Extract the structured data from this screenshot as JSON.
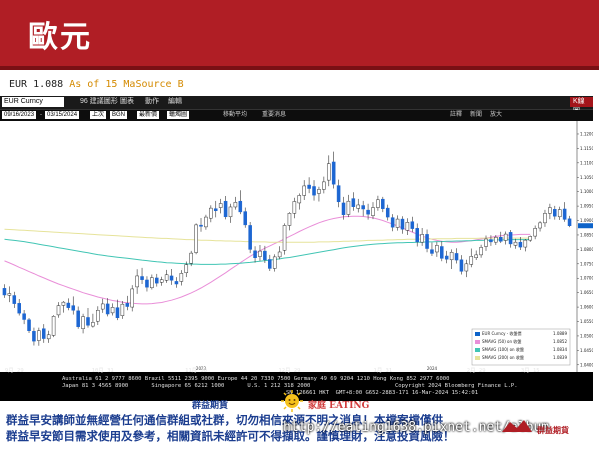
{
  "banner": {
    "title": "歐元"
  },
  "source": {
    "ticker": "EUR 1.088",
    "label": "As of 15 Ma",
    "source": "Source B"
  },
  "toolbar": {
    "ticker": "EUR Curncy",
    "items": [
      "96 建議圖形",
      "圖表",
      "動作",
      "編輯"
    ],
    "right_label": "K線圖"
  },
  "toolbar2": {
    "start_date": "09/16/2023",
    "end_date": "03/15/2024",
    "period_button": "上次",
    "currency": "BGN",
    "frequency": "最新價",
    "chart_type": "蠟燭圖",
    "checkbox_1": "移動平均",
    "checkbox_2": "重要消息",
    "right_items": [
      "註釋",
      "新聞",
      "放大"
    ]
  },
  "footer": {
    "line1": "Australia 61 2 9777 8600 Brazil 5511 2395 9000 Europe 44 20 7330 7500 Germany 49 69 9204 1210 Hong Kong 852 2977 6000",
    "line2": "Japan 81 3 4565 8900       Singapore 65 6212 1000       U.S. 1 212 318 2000",
    "line3": "SN 126661 HKT  GMT+8:00 G652-2883-171 16-Mar-2024 15:42:01",
    "copyright": "Copyright 2024 Bloomberg Finance L.P."
  },
  "chart_data": {
    "type": "candlestick",
    "ylim": [
      1.0375,
      1.1245
    ],
    "y_ticks": [
      1.04,
      1.045,
      1.05,
      1.055,
      1.06,
      1.065,
      1.07,
      1.075,
      1.08,
      1.085,
      1.09,
      1.095,
      1.1,
      1.105,
      1.11,
      1.115,
      1.12
    ],
    "y_tick_labels": [
      "1.0400",
      "1.0450",
      "1.0500",
      "1.0550",
      "1.0600",
      "1.0650",
      "1.0700",
      "1.0750",
      "1.0800",
      "1.0850",
      "1.0900",
      "1.0950",
      "1.1000",
      "1.1050",
      "1.1100",
      "1.1150",
      "1.1200"
    ],
    "x_ticks": [
      {
        "index": 2,
        "label": "9月 29"
      },
      {
        "index": 20,
        "label": "10月 31"
      },
      {
        "index": 39,
        "label": "11月 30"
      },
      {
        "index": 58,
        "label": "12月 29"
      },
      {
        "index": 77,
        "label": "1月 31"
      },
      {
        "index": 96,
        "label": "2月 29"
      },
      {
        "index": 107,
        "label": "3月 15"
      }
    ],
    "x_year_labels": [
      {
        "index": 40,
        "label": "2023"
      },
      {
        "index": 87,
        "label": "2024"
      }
    ],
    "candles": [
      [
        1.0665,
        1.0679,
        1.0632,
        1.0642
      ],
      [
        1.0641,
        1.0672,
        1.0617,
        1.0647
      ],
      [
        1.064,
        1.0653,
        1.0597,
        1.0612
      ],
      [
        1.0613,
        1.0628,
        1.0571,
        1.0579
      ],
      [
        1.0577,
        1.059,
        1.0541,
        1.0557
      ],
      [
        1.0556,
        1.0562,
        1.051,
        1.0518
      ],
      [
        1.0516,
        1.0529,
        1.0467,
        1.0482
      ],
      [
        1.0484,
        1.0529,
        1.0466,
        1.0518
      ],
      [
        1.0525,
        1.0541,
        1.0476,
        1.0491
      ],
      [
        1.049,
        1.0518,
        1.0476,
        1.0504
      ],
      [
        1.0502,
        1.0572,
        1.0496,
        1.0568
      ],
      [
        1.0573,
        1.0617,
        1.0563,
        1.0605
      ],
      [
        1.0606,
        1.0621,
        1.0581,
        1.0617
      ],
      [
        1.0614,
        1.063,
        1.0589,
        1.0598
      ],
      [
        1.0605,
        1.0637,
        1.0574,
        1.0589
      ],
      [
        1.0587,
        1.0602,
        1.0525,
        1.0532
      ],
      [
        1.0525,
        1.0577,
        1.0509,
        1.0567
      ],
      [
        1.0564,
        1.0597,
        1.0529,
        1.0537
      ],
      [
        1.0534,
        1.0577,
        1.0529,
        1.0547
      ],
      [
        1.0551,
        1.0603,
        1.0538,
        1.0589
      ],
      [
        1.0593,
        1.0629,
        1.058,
        1.0611
      ],
      [
        1.0611,
        1.0631,
        1.0568,
        1.0576
      ],
      [
        1.058,
        1.0613,
        1.0571,
        1.0599
      ],
      [
        1.0598,
        1.0626,
        1.0555,
        1.0563
      ],
      [
        1.057,
        1.0621,
        1.0559,
        1.061
      ],
      [
        1.0613,
        1.0639,
        1.0589,
        1.0602
      ],
      [
        1.06,
        1.0676,
        1.0585,
        1.0663
      ],
      [
        1.067,
        1.0731,
        1.0646,
        1.0708
      ],
      [
        1.0706,
        1.0736,
        1.068,
        1.0695
      ],
      [
        1.0694,
        1.0707,
        1.0654,
        1.0669
      ],
      [
        1.0667,
        1.0713,
        1.0661,
        1.0702
      ],
      [
        1.0701,
        1.0715,
        1.0671,
        1.0683
      ],
      [
        1.0686,
        1.0705,
        1.0674,
        1.0695
      ],
      [
        1.0693,
        1.0729,
        1.0684,
        1.0712
      ],
      [
        1.0708,
        1.0732,
        1.0677,
        1.0693
      ],
      [
        1.0689,
        1.0704,
        1.0667,
        1.068
      ],
      [
        1.0689,
        1.0728,
        1.0675,
        1.0717
      ],
      [
        1.0719,
        1.0758,
        1.0704,
        1.0747
      ],
      [
        1.0752,
        1.0795,
        1.0742,
        1.0787
      ],
      [
        1.0789,
        1.089,
        1.0783,
        1.0885
      ],
      [
        1.0884,
        1.0909,
        1.0861,
        1.088
      ],
      [
        1.0878,
        1.092,
        1.0868,
        1.0912
      ],
      [
        1.0908,
        1.0953,
        1.0894,
        1.0943
      ],
      [
        1.0941,
        1.0968,
        1.0911,
        1.0934
      ],
      [
        1.0945,
        1.0975,
        1.0925,
        1.0959
      ],
      [
        1.0967,
        1.0985,
        1.0904,
        1.0913
      ],
      [
        1.0913,
        1.0958,
        1.0892,
        1.0947
      ],
      [
        1.0947,
        1.0982,
        1.0938,
        1.0963
      ],
      [
        1.0967,
        1.1005,
        1.0922,
        1.093
      ],
      [
        1.0931,
        1.0945,
        1.0875,
        1.0885
      ],
      [
        1.0883,
        1.0895,
        1.0787,
        1.08
      ],
      [
        1.0795,
        1.0811,
        1.0754,
        1.0771
      ],
      [
        1.0775,
        1.0815,
        1.076,
        1.0794
      ],
      [
        1.0794,
        1.0812,
        1.0753,
        1.0764
      ],
      [
        1.0765,
        1.0781,
        1.0725,
        1.0734
      ],
      [
        1.0734,
        1.0783,
        1.0723,
        1.0774
      ],
      [
        1.0774,
        1.0811,
        1.0766,
        1.0791
      ],
      [
        1.0797,
        1.089,
        1.0782,
        1.0883
      ],
      [
        1.0883,
        1.0929,
        1.0866,
        1.0925
      ],
      [
        1.0925,
        1.0979,
        1.0908,
        1.0966
      ],
      [
        1.0961,
        1.0994,
        1.0938,
        1.0987
      ],
      [
        1.0987,
        1.104,
        1.0971,
        1.102
      ],
      [
        1.1023,
        1.105,
        1.0995,
        1.1011
      ],
      [
        1.1018,
        1.104,
        1.0969,
        1.0988
      ],
      [
        1.0994,
        1.1017,
        1.0966,
        1.1008
      ],
      [
        1.1008,
        1.1052,
        1.0994,
        1.1034
      ],
      [
        1.104,
        1.1126,
        1.1019,
        1.1097
      ],
      [
        1.1103,
        1.1139,
        1.1011,
        1.1026
      ],
      [
        1.1021,
        1.1042,
        1.0946,
        1.0965
      ],
      [
        1.0961,
        1.0982,
        1.0903,
        1.092
      ],
      [
        1.0921,
        1.0989,
        1.0912,
        1.0967
      ],
      [
        1.0976,
        1.0998,
        1.0934,
        1.0948
      ],
      [
        1.0942,
        1.0975,
        1.0928,
        1.0954
      ],
      [
        1.0952,
        1.0968,
        1.0915,
        1.094
      ],
      [
        1.0936,
        1.0958,
        1.0903,
        1.0922
      ],
      [
        1.0917,
        1.0964,
        1.0905,
        1.0945
      ],
      [
        1.0945,
        1.0986,
        1.0934,
        1.0972
      ],
      [
        1.0974,
        1.0982,
        1.0929,
        1.0941
      ],
      [
        1.0943,
        1.0955,
        1.09,
        1.0912
      ],
      [
        1.091,
        1.0922,
        1.0863,
        1.0877
      ],
      [
        1.0876,
        1.0918,
        1.0865,
        1.0905
      ],
      [
        1.0905,
        1.0915,
        1.0854,
        1.087
      ],
      [
        1.0866,
        1.0908,
        1.085,
        1.0894
      ],
      [
        1.0896,
        1.0913,
        1.086,
        1.0872
      ],
      [
        1.0873,
        1.089,
        1.081,
        1.0826
      ],
      [
        1.0825,
        1.0874,
        1.0812,
        1.0852
      ],
      [
        1.0852,
        1.0869,
        1.079,
        1.0803
      ],
      [
        1.0799,
        1.0824,
        1.0777,
        1.0786
      ],
      [
        1.0791,
        1.0826,
        1.0774,
        1.0814
      ],
      [
        1.081,
        1.0828,
        1.0759,
        1.0769
      ],
      [
        1.0777,
        1.0795,
        1.0752,
        1.0766
      ],
      [
        1.0764,
        1.08,
        1.0732,
        1.079
      ],
      [
        1.0786,
        1.0804,
        1.0751,
        1.0763
      ],
      [
        1.0764,
        1.078,
        1.0713,
        1.0724
      ],
      [
        1.0725,
        1.0764,
        1.0704,
        1.075
      ],
      [
        1.0748,
        1.0803,
        1.0738,
        1.0776
      ],
      [
        1.0771,
        1.0796,
        1.0763,
        1.0781
      ],
      [
        1.0781,
        1.0816,
        1.0771,
        1.0807
      ],
      [
        1.081,
        1.0848,
        1.0795,
        1.0836
      ],
      [
        1.0834,
        1.0849,
        1.0812,
        1.0826
      ],
      [
        1.0825,
        1.085,
        1.0815,
        1.0842
      ],
      [
        1.0842,
        1.0861,
        1.0822,
        1.0828
      ],
      [
        1.0831,
        1.0862,
        1.0817,
        1.0853
      ],
      [
        1.0859,
        1.0867,
        1.0806,
        1.0819
      ],
      [
        1.0814,
        1.0837,
        1.0802,
        1.0825
      ],
      [
        1.0825,
        1.0843,
        1.0798,
        1.0808
      ],
      [
        1.0808,
        1.0836,
        1.0793,
        1.0832
      ],
      [
        1.0832,
        1.0848,
        1.0826,
        1.0845
      ],
      [
        1.0846,
        1.0883,
        1.0835,
        1.0873
      ],
      [
        1.0874,
        1.0898,
        1.0862,
        1.0892
      ],
      [
        1.0892,
        1.0937,
        1.0878,
        1.0925
      ],
      [
        1.0925,
        1.0958,
        1.0905,
        1.0945
      ],
      [
        1.0939,
        1.0951,
        1.0903,
        1.0915
      ],
      [
        1.0913,
        1.0948,
        1.0902,
        1.0938
      ],
      [
        1.094,
        1.0964,
        1.0896,
        1.0904
      ],
      [
        1.0906,
        1.0916,
        1.0877,
        1.0882
      ]
    ],
    "series": [
      {
        "name": "EUR Curncy - 收盤價",
        "color": "#0d63c9",
        "last": 1.0889
      },
      {
        "name": "SMAVG (50) on 收盤",
        "color": "#e98ed8",
        "last": 1.0852,
        "values": [
          1.076,
          1.0753,
          1.0746,
          1.0738,
          1.0731,
          1.0723,
          1.0716,
          1.0708,
          1.0701,
          1.0694,
          1.0687,
          1.068,
          1.0674,
          1.0668,
          1.0662,
          1.0656,
          1.065,
          1.0645,
          1.064,
          1.0635,
          1.0631,
          1.0627,
          1.0623,
          1.062,
          1.0617,
          1.0615,
          1.0613,
          1.0612,
          1.0611,
          1.0611,
          1.0612,
          1.0614,
          1.0616,
          1.062,
          1.0624,
          1.0629,
          1.0635,
          1.0642,
          1.0649,
          1.0657,
          1.0666,
          1.0676,
          1.0686,
          1.0697,
          1.0708,
          1.0719,
          1.0731,
          1.0742,
          1.0754,
          1.0765,
          1.0776,
          1.0786,
          1.0795,
          1.0804,
          1.0812,
          1.082,
          1.0828,
          1.0836,
          1.0845,
          1.0853,
          1.0862,
          1.087,
          1.0878,
          1.0885,
          1.0892,
          1.0898,
          1.0903,
          1.0907,
          1.091,
          1.0913,
          1.0914,
          1.0915,
          1.0915,
          1.0914,
          1.0912,
          1.0909,
          1.0905,
          1.09,
          1.0894,
          1.0888,
          1.0881,
          1.0874,
          1.0867,
          1.086,
          1.0853,
          1.0846,
          1.084,
          1.0835,
          1.0831,
          1.0828,
          1.0826,
          1.0825,
          1.0825,
          1.0826,
          1.0828,
          1.083,
          1.0833,
          1.0836,
          1.0839,
          1.0842,
          1.0845,
          1.0847,
          1.0849,
          1.085,
          1.0851,
          1.0852,
          1.0852,
          1.0852
        ]
      },
      {
        "name": "SMAVG (100) on 收盤",
        "color": "#41c5b4",
        "last": 1.0834,
        "values": [
          1.0835,
          1.0833,
          1.0831,
          1.0829,
          1.0827,
          1.0824,
          1.0821,
          1.0818,
          1.0815,
          1.0812,
          1.0809,
          1.0806,
          1.0803,
          1.08,
          1.0797,
          1.0794,
          1.0791,
          1.0788,
          1.0785,
          1.0782,
          1.078,
          1.0777,
          1.0775,
          1.0773,
          1.0771,
          1.0769,
          1.0767,
          1.0765,
          1.0763,
          1.0761,
          1.0759,
          1.0757,
          1.0756,
          1.0754,
          1.0753,
          1.0752,
          1.0751,
          1.075,
          1.0749,
          1.0749,
          1.0748,
          1.0748,
          1.0748,
          1.0748,
          1.0749,
          1.0749,
          1.075,
          1.0751,
          1.0752,
          1.0754,
          1.0755,
          1.0757,
          1.0759,
          1.0761,
          1.0763,
          1.0765,
          1.0767,
          1.077,
          1.0772,
          1.0775,
          1.0778,
          1.0781,
          1.0784,
          1.0787,
          1.079,
          1.0793,
          1.0796,
          1.0799,
          1.0802,
          1.0805,
          1.0808,
          1.081,
          1.0812,
          1.0814,
          1.0816,
          1.0818,
          1.0819,
          1.082,
          1.0821,
          1.0822,
          1.0823,
          1.0823,
          1.0824,
          1.0824,
          1.0825,
          1.0825,
          1.0826,
          1.0826,
          1.0827,
          1.0827,
          1.0828,
          1.0828,
          1.0829,
          1.0829,
          1.083,
          1.083,
          1.0831,
          1.0831,
          1.0832,
          1.0832,
          1.0833,
          1.0833,
          1.0833,
          1.0834,
          1.0834,
          1.0834,
          1.0834,
          1.0834
        ]
      },
      {
        "name": "SMAVG (200) on 收盤",
        "color": "#e6e39a",
        "last": 1.0839,
        "values": [
          1.087,
          1.0869,
          1.0868,
          1.0867,
          1.0866,
          1.0865,
          1.0864,
          1.0863,
          1.0862,
          1.0861,
          1.086,
          1.0859,
          1.0858,
          1.0857,
          1.0856,
          1.0855,
          1.0854,
          1.0853,
          1.0852,
          1.0851,
          1.085,
          1.0849,
          1.0848,
          1.0847,
          1.0846,
          1.0845,
          1.0844,
          1.0843,
          1.0842,
          1.0841,
          1.084,
          1.0839,
          1.0838,
          1.0838,
          1.0837,
          1.0836,
          1.0835,
          1.0834,
          1.0834,
          1.0833,
          1.0832,
          1.0832,
          1.0831,
          1.083,
          1.083,
          1.0829,
          1.0829,
          1.0828,
          1.0828,
          1.0827,
          1.0827,
          1.0826,
          1.0826,
          1.0826,
          1.0825,
          1.0825,
          1.0825,
          1.0825,
          1.0825,
          1.0825,
          1.0825,
          1.0825,
          1.0825,
          1.0825,
          1.0826,
          1.0826,
          1.0826,
          1.0827,
          1.0827,
          1.0828,
          1.0828,
          1.0829,
          1.0829,
          1.083,
          1.0831,
          1.0831,
          1.0832,
          1.0832,
          1.0833,
          1.0833,
          1.0834,
          1.0834,
          1.0835,
          1.0835,
          1.0835,
          1.0836,
          1.0836,
          1.0836,
          1.0837,
          1.0837,
          1.0837,
          1.0837,
          1.0838,
          1.0838,
          1.0838,
          1.0838,
          1.0838,
          1.0839,
          1.0839,
          1.0839,
          1.0839,
          1.0839,
          1.0839,
          1.0839,
          1.0839,
          1.0839,
          1.0839,
          1.0839
        ]
      }
    ],
    "legend_position": "bottom-right",
    "grid": false
  },
  "watermark": {
    "logo_left": "群益期貨",
    "logo_right": "家庭",
    "logo_eat": "EATING",
    "url": "http://eating1638.pixnet.net/album",
    "brand": "群益期貨"
  },
  "disclaimer": {
    "line1": "群益早安講師並無經營任何通信群組或社群，切勿相信來源不明之消息！本檔案檔僅供",
    "line2": "群益早安節目需求使用及參考，相關資訊未經許可不得擷取。謹慎理財，注意投資風險！"
  },
  "colors": {
    "banner": "#b01e25",
    "up_candle": "#ffffff",
    "down_candle": "#1d66d2",
    "candle_outline": "#333333"
  }
}
